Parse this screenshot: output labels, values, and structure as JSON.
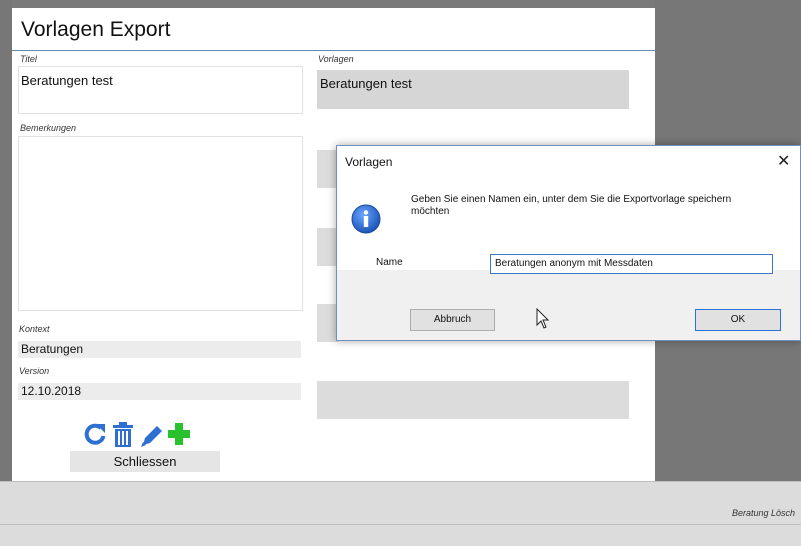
{
  "export_window": {
    "title": "Vorlagen Export",
    "titel_label": "Titel",
    "titel_value": "Beratungen test",
    "vorlagen_label": "Vorlagen",
    "vorlagen_selected": "Beratungen test",
    "bemerkungen_label": "Bemerkungen",
    "kontext_label": "Kontext",
    "kontext_value": "Beratungen",
    "version_label": "Version",
    "version_value": "12.10.2018",
    "toolbar_icons": [
      "refresh-icon",
      "trash-icon",
      "pencil-icon",
      "plus-icon"
    ],
    "close_button": "Schliessen"
  },
  "background": {
    "bottom_right_text": "Beratung Lösch"
  },
  "dialog": {
    "title": "Vorlagen",
    "close_glyph": "✕",
    "message": "Geben Sie einen Namen ein, unter dem Sie die Exportvorlage speichern möchten",
    "icon": "info-icon",
    "name_label": "Name",
    "name_value": "Beratungen anonym mit Messdaten",
    "cancel_button": "Abbruch",
    "ok_button": "OK"
  },
  "colors": {
    "accent": "#2a74d8",
    "tool_blue": "#2f6fd1",
    "tool_green": "#29c22e"
  }
}
